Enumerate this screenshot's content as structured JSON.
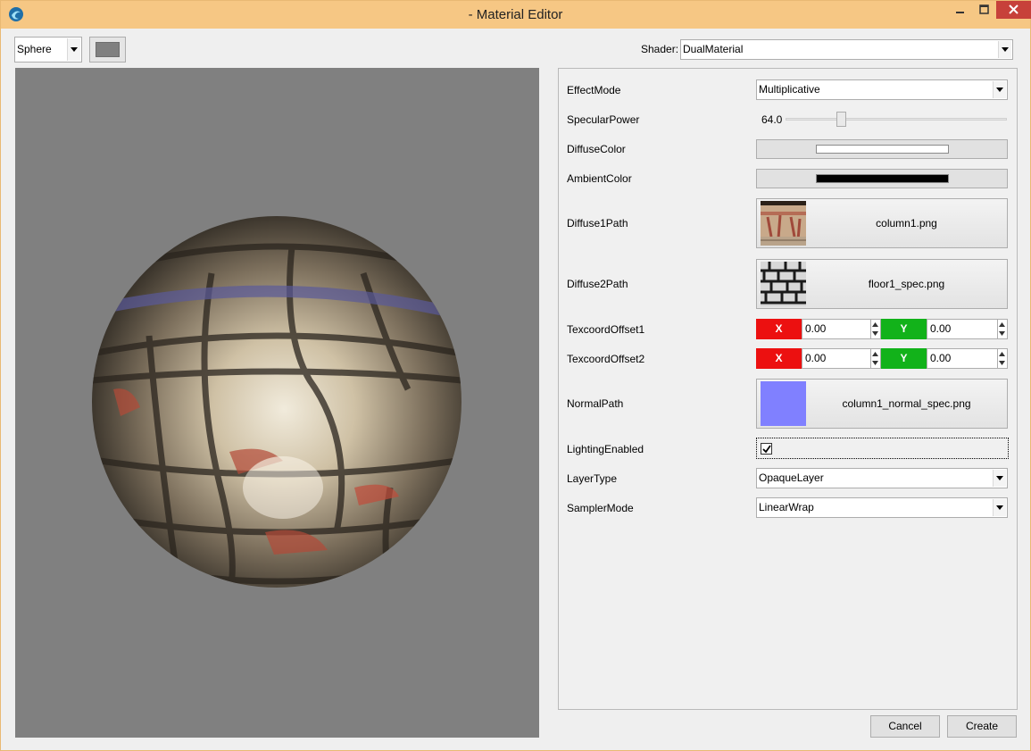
{
  "window": {
    "title": "- Material Editor"
  },
  "toolbar": {
    "geometry": "Sphere",
    "background_color": "#808080",
    "shader_label": "Shader:",
    "shader_value": "DualMaterial"
  },
  "properties": {
    "effect_mode": {
      "label": "EffectMode",
      "value": "Multiplicative"
    },
    "specular_power": {
      "label": "SpecularPower",
      "value": "64.0"
    },
    "diffuse_color": {
      "label": "DiffuseColor",
      "color": "#ffffff"
    },
    "ambient_color": {
      "label": "AmbientColor",
      "color": "#000000"
    },
    "diffuse1_path": {
      "label": "Diffuse1Path",
      "file": "column1.png"
    },
    "diffuse2_path": {
      "label": "Diffuse2Path",
      "file": "floor1_spec.png"
    },
    "texcoord_offset1": {
      "label": "TexcoordOffset1",
      "x_label": "X",
      "x": "0.00",
      "y_label": "Y",
      "y": "0.00"
    },
    "texcoord_offset2": {
      "label": "TexcoordOffset2",
      "x_label": "X",
      "x": "0.00",
      "y_label": "Y",
      "y": "0.00"
    },
    "normal_path": {
      "label": "NormalPath",
      "file": "column1_normal_spec.png",
      "thumb_color": "#8080ff"
    },
    "lighting_enabled": {
      "label": "LightingEnabled",
      "checked": true
    },
    "layer_type": {
      "label": "LayerType",
      "value": "OpaqueLayer"
    },
    "sampler_mode": {
      "label": "SamplerMode",
      "value": "LinearWrap"
    }
  },
  "buttons": {
    "cancel": "Cancel",
    "create": "Create"
  },
  "colors": {
    "titlebar": "#f6c784",
    "close_button": "#c7413a",
    "viewport_bg": "#808080",
    "axis_x": "#ec1010",
    "axis_y": "#12b21a"
  }
}
